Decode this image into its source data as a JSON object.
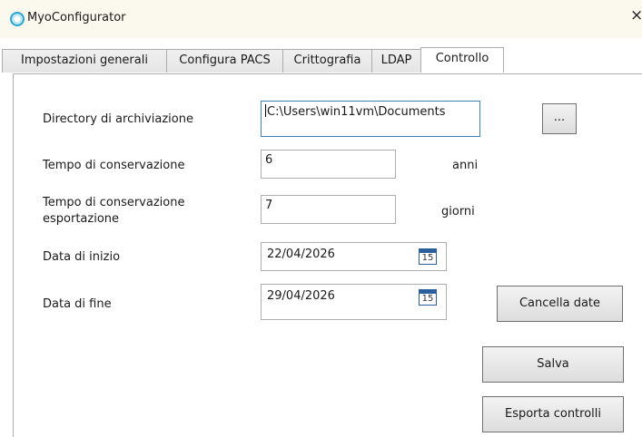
{
  "window": {
    "title": "MyoConfigurator",
    "close_glyph": "×"
  },
  "tabs": [
    {
      "label": "Impostazioni generali"
    },
    {
      "label": "Configura PACS"
    },
    {
      "label": "Crittografia"
    },
    {
      "label": "LDAP"
    },
    {
      "label": "Controllo",
      "selected": true
    }
  ],
  "form": {
    "archive_dir": {
      "label": "Directory di archiviazione",
      "value": "C:\\Users\\win11vm\\Documents",
      "browse_label": "..."
    },
    "retention": {
      "label": "Tempo di conservazione",
      "value": "6",
      "unit": "anni"
    },
    "export_retention": {
      "label_line1": "Tempo di conservazione",
      "label_line2": "esportazione",
      "value": "7",
      "unit": "giorni"
    },
    "start_date": {
      "label": "Data di inizio",
      "value": "22/04/2026",
      "calendar_day": "15"
    },
    "end_date": {
      "label": "Data di fine",
      "value": "29/04/2026",
      "calendar_day": "15"
    }
  },
  "buttons": {
    "clear_dates": "Cancella date",
    "save": "Salva",
    "export_checks": "Esporta controlli"
  }
}
